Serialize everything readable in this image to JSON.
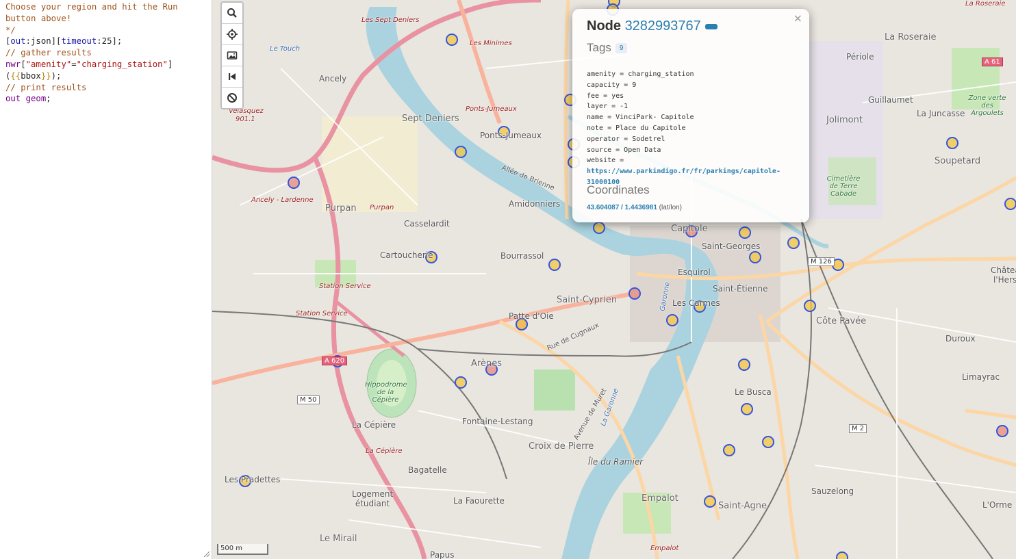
{
  "editor": {
    "lines": [
      {
        "segments": [
          {
            "t": "Choose your region and hit the Run",
            "c": "comment"
          }
        ]
      },
      {
        "segments": [
          {
            "t": "button above!",
            "c": "comment"
          }
        ]
      },
      {
        "segments": [
          {
            "t": "*/",
            "c": "comment"
          }
        ]
      },
      {
        "segments": [
          {
            "t": "[",
            "c": "bracket"
          },
          {
            "t": "out",
            "c": "key"
          },
          {
            "t": ":json][",
            "c": "bracket"
          },
          {
            "t": "timeout",
            "c": "key"
          },
          {
            "t": ":25];",
            "c": "bracket"
          }
        ]
      },
      {
        "segments": [
          {
            "t": "// gather results",
            "c": "comment"
          }
        ]
      },
      {
        "segments": [
          {
            "t": "nwr",
            "c": "kw"
          },
          {
            "t": "[",
            "c": "bracket"
          },
          {
            "t": "\"amenity\"",
            "c": "str"
          },
          {
            "t": "=",
            "c": "bracket"
          },
          {
            "t": "\"charging_station\"",
            "c": "str"
          },
          {
            "t": "]",
            "c": "bracket"
          }
        ]
      },
      {
        "segments": [
          {
            "t": "(",
            "c": "bracket"
          },
          {
            "t": "{{",
            "c": "tpl"
          },
          {
            "t": "bbox",
            "c": "bracket"
          },
          {
            "t": "}}",
            "c": "tpl"
          },
          {
            "t": ");",
            "c": "bracket"
          }
        ]
      },
      {
        "segments": [
          {
            "t": "// print results",
            "c": "comment"
          }
        ]
      },
      {
        "segments": [
          {
            "t": "out geom",
            "c": "kw"
          },
          {
            "t": ";",
            "c": "bracket"
          }
        ]
      }
    ]
  },
  "map": {
    "toolbar": [
      "search-icon",
      "locate-icon",
      "image-icon",
      "skip-back-icon",
      "block-icon"
    ],
    "scale": "500 m",
    "labels": {
      "ancely": "Ancely",
      "sept_deniers": "Sept Deniers",
      "ponts_jumeaux": "Ponts-Jumeaux",
      "purpan": "Purpan",
      "amidonniers": "Amidonniers",
      "casselardit": "Casselardit",
      "cartoucherie": "Cartoucherie",
      "bourrassol": "Bourrassol",
      "saint_cyprien": "Saint-Cyprien",
      "patte_doie": "Patte d'Oie",
      "arenes": "Arènes",
      "fontaine_lestang": "Fontaine-Lestang",
      "la_cepiere": "La Cépière",
      "croix_de_pierre": "Croix de Pierre",
      "ile_du_ramier": "Île du Ramier",
      "bagatelle": "Bagatelle",
      "logement_etudiant": "Logement étudiant",
      "la_faourette": "La Faourette",
      "le_mirail": "Le Mirail",
      "les_pradettes": "Les Pradettes",
      "papus": "Papus",
      "empalot": "Empalot",
      "saint_agne": "Saint-Agne",
      "le_busca": "Le Busca",
      "esquirol": "Esquirol",
      "les_carmes": "Les Carmes",
      "saint_etienne": "Saint-Étienne",
      "saint_georges": "Saint-Georges",
      "capitole": "Capitole",
      "cote_pavee": "Côte Pavée",
      "la_roseraie": "La Roseraie",
      "periole": "Périole",
      "guillaumet": "Guillaumet",
      "la_juncasse": "La Juncasse",
      "jolimont": "Jolimont",
      "soupetard": "Soupetard",
      "duroux": "Duroux",
      "limayrac": "Limayrac",
      "sauzelong": "Sauzelong",
      "lorme": "L'Orme",
      "chateau": "Château",
      "lhers": "l'Hers",
      "hippodrome": "Hippodrome de la Cépière",
      "cimetiere": "Cimetière de Terre Cabade",
      "zone_verte": "Zone verte des Argoulets",
      "station_service_1": "Station Service",
      "station_service_2": "Station Service",
      "velasquez": "Velasquez",
      "velasquez_num": "901.1",
      "ancely_lardenne": "Ancely - Lardenne",
      "garonne": "Garonne",
      "la_garonne": "La Garonne",
      "le_touch": "Le Touch",
      "m126": "M 126",
      "a620": "A 620",
      "m50": "M 50",
      "m2": "M 2",
      "a61": "A 61",
      "rue_cugnaux": "Rue de Cugnaux",
      "allee_brienne": "Allée de Brienne",
      "avenue_muret": "Avenue de Muret",
      "les_sept_deniers_road": "Les Sept Deniers",
      "les_minimes_road": "Les Minimes",
      "ponts_jumeaux_road": "Ponts-Jumeaux",
      "purpan_road": "Purpan",
      "la_cepiere_road": "La Cépière",
      "empalot_road": "Empalot",
      "la_roseraie_road": "La Roseraie"
    }
  },
  "popup": {
    "title_prefix": "Node",
    "node_id": "3282993767",
    "tags_heading": "Tags",
    "tags_count": "9",
    "tags": [
      "amenity = charging_station",
      "capacity = 9",
      "fee = yes",
      "layer = -1",
      "name = VinciPark- Capitole",
      "note = Place du Capitole",
      "operator = Sodetrel",
      "source = Open Data",
      "website ="
    ],
    "website_url_line1": "https://www.parkindigo.fr/fr/parkings/capitole-",
    "website_url_line2": "31000100",
    "coordinates_heading": "Coordinates",
    "coordinates": "43.604087 / 1.4436981",
    "coordinates_suffix": "(lat/lon)",
    "close_label": "×"
  },
  "colors": {
    "marker_fill": "#f4c542",
    "marker_stroke": "#3355dd",
    "marker_selected": "#e88a7a",
    "river": "#aad3df",
    "motorway": "#e892a2",
    "trunk": "#f9b29c",
    "primary": "#fcd6a4",
    "link": "#2a7fb0"
  }
}
